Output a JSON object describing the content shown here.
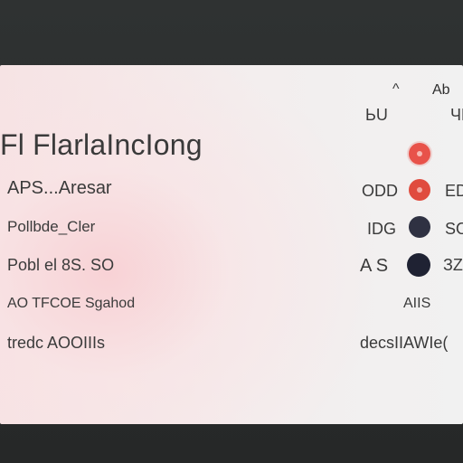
{
  "window": {
    "header_left": "^",
    "header_right": "Ab"
  },
  "title": "Fl FlarlaIncIong",
  "col_headers": {
    "mid": "ЬU",
    "right": "ЧD"
  },
  "rows": [
    {
      "label": "APS...Aresar",
      "mid": "",
      "right": "",
      "dot_color": "#e8524a"
    },
    {
      "label": "Pollbde_Cler",
      "mid": "ODD",
      "right": "ЕD",
      "dot_color": "#e04b3e"
    },
    {
      "label": "Pobl el 8S. SO",
      "mid": "IDG",
      "right": "SO",
      "dot_color": "#2f3142"
    },
    {
      "label": "AO TFCOE Sgahod",
      "mid": "A S",
      "right": "ЗZ",
      "dot_color": "#1f2233"
    },
    {
      "label": "tredc AOOIIIs",
      "mid": "AIIS",
      "right": "",
      "dot_color": ""
    },
    {
      "label": "",
      "mid": "decsIIAWIe(",
      "right": "",
      "dot_color": ""
    }
  ],
  "colors": {
    "accent_red": "#e8524a",
    "dark_dot": "#23263a",
    "background": "#2b2d2d",
    "card": "#f2eeee"
  }
}
